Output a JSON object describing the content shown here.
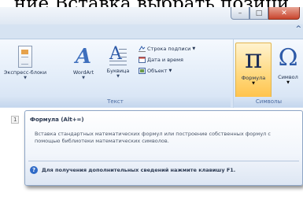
{
  "page_text": "ние Вставка выбрать позици",
  "window": {
    "controls": {
      "minimize": "–",
      "maximize": "□",
      "close": "✕"
    },
    "help_chevron": "^"
  },
  "ribbon": {
    "groups": [
      {
        "label": "Текст",
        "buttons": [
          {
            "label": "Экспресс-блоки",
            "icon": "express-blocks-icon"
          },
          {
            "label": "WordArt",
            "icon": "wordart-icon"
          },
          {
            "label": "Буквица",
            "icon": "dropcap-icon"
          }
        ],
        "small_buttons": [
          {
            "label": "Строка подписи",
            "icon": "signature-line-icon"
          },
          {
            "label": "Дата и время",
            "icon": "date-time-icon"
          },
          {
            "label": "Объект",
            "icon": "object-icon"
          }
        ]
      },
      {
        "label": "Символы",
        "buttons": [
          {
            "label": "Формула",
            "icon": "pi-formula-icon",
            "glyph": "π"
          },
          {
            "label": "Символ",
            "icon": "omega-symbol-icon",
            "glyph": "Ω"
          }
        ]
      }
    ]
  },
  "ruler_mark": "1",
  "tooltip": {
    "title": "Формула (Alt+=)",
    "body": "Вставка стандартных математических формул или построение собственных формул с помощью библиотеки математических символов.",
    "help_text": "Для получения дополнительных сведений нажмите клавишу F1."
  },
  "colors": {
    "ribbon_bg": "#e3edf9",
    "highlight": "#ffd77a",
    "tooltip_border": "#8ea6c6"
  }
}
